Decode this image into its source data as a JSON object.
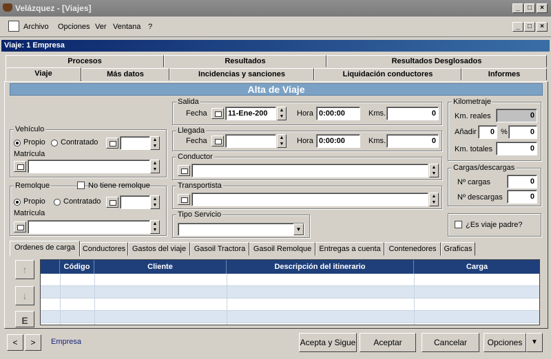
{
  "window": {
    "title": "Velázquez - [Viajes]",
    "min": "_",
    "max": "□",
    "close": "×",
    "restore": "ₗ"
  },
  "menu": {
    "archivo": "Archivo",
    "opciones": "Opciones",
    "ver": "Ver",
    "ventana": "Ventana",
    "help": "?"
  },
  "form": {
    "caption": "Viaje: 1 Empresa",
    "banner": "Alta de Viaje"
  },
  "tabs_top": [
    "Procesos",
    "Resultados",
    "Resultados Desglosados"
  ],
  "tabs_bottom": [
    "Viaje",
    "Más datos",
    "Incidencias y sanciones",
    "Liquidación conductores",
    "Informes"
  ],
  "vehiculo": {
    "group": "Vehículo",
    "propio": "Propio",
    "contratado": "Contratado",
    "matricula": "Matrícula"
  },
  "remolque": {
    "group": "Remolque",
    "no_tiene": "No tiene remolque",
    "propio": "Propio",
    "contratado": "Contratado",
    "matricula": "Matrícula"
  },
  "salida": {
    "group": "Salida",
    "fecha_label": "Fecha",
    "fecha": "11-Ene-200",
    "hora_label": "Hora",
    "hora": "0:00:00",
    "kms_label": "Kms.",
    "kms": "0"
  },
  "llegada": {
    "group": "Llegada",
    "fecha_label": "Fecha",
    "hora_label": "Hora",
    "hora": "0:00:00",
    "kms_label": "Kms.",
    "kms": "0"
  },
  "conductor": {
    "group": "Conductor"
  },
  "transportista": {
    "group": "Transportista"
  },
  "tipo_servicio": {
    "group": "Tipo Servicio"
  },
  "kilometraje": {
    "group": "Kilometraje",
    "reales_label": "Km. reales",
    "reales": "0",
    "anadir_label": "Añadir",
    "anadir": "0",
    "pct_label": "%",
    "pct": "0",
    "totales_label": "Km. totales",
    "totales": "0"
  },
  "cargas": {
    "group": "Cargas/descargas",
    "cargas_label": "Nº cargas",
    "cargas": "0",
    "descargas_label": "Nº descargas",
    "descargas": "0"
  },
  "viaje_padre": "¿Es viaje padre?",
  "lower_tabs": [
    "Ordenes de carga",
    "Conductores",
    "Gastos del viaje",
    "Gasoil Tractora",
    "Gasoil Remolque",
    "Entregas a cuenta",
    "Contenedores",
    "Graficas"
  ],
  "grid": {
    "columns": [
      "Código",
      "Cliente",
      "Descripción del itinerario",
      "Carga"
    ]
  },
  "side_buttons": {
    "up": "↑",
    "down": "↓",
    "edit": "E"
  },
  "bottom": {
    "prev": "<",
    "next": ">",
    "empresa": "Empresa",
    "acepta_sigue": "Acepta y Sigue",
    "aceptar": "Aceptar",
    "cancelar": "Cancelar",
    "opciones": "Opciones",
    "arrow": "▼"
  }
}
